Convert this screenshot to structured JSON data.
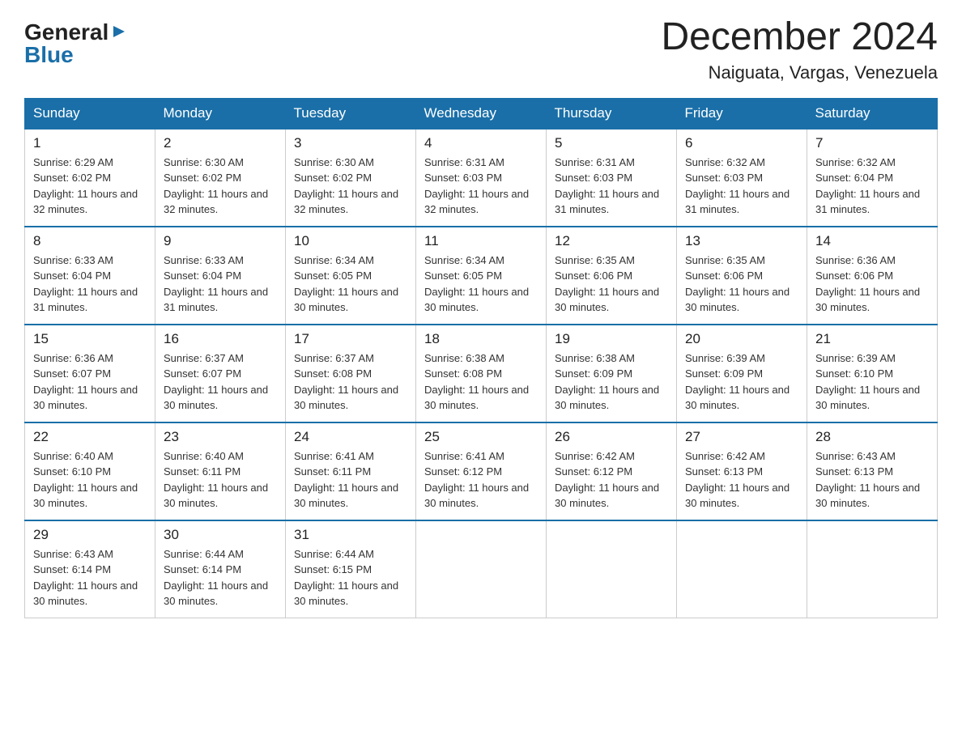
{
  "header": {
    "logo": {
      "general": "General",
      "arrow": "▶",
      "blue": "Blue"
    },
    "title": "December 2024",
    "location": "Naiguata, Vargas, Venezuela"
  },
  "calendar": {
    "days_of_week": [
      "Sunday",
      "Monday",
      "Tuesday",
      "Wednesday",
      "Thursday",
      "Friday",
      "Saturday"
    ],
    "weeks": [
      [
        {
          "day": "1",
          "sunrise": "6:29 AM",
          "sunset": "6:02 PM",
          "daylight": "11 hours and 32 minutes."
        },
        {
          "day": "2",
          "sunrise": "6:30 AM",
          "sunset": "6:02 PM",
          "daylight": "11 hours and 32 minutes."
        },
        {
          "day": "3",
          "sunrise": "6:30 AM",
          "sunset": "6:02 PM",
          "daylight": "11 hours and 32 minutes."
        },
        {
          "day": "4",
          "sunrise": "6:31 AM",
          "sunset": "6:03 PM",
          "daylight": "11 hours and 32 minutes."
        },
        {
          "day": "5",
          "sunrise": "6:31 AM",
          "sunset": "6:03 PM",
          "daylight": "11 hours and 31 minutes."
        },
        {
          "day": "6",
          "sunrise": "6:32 AM",
          "sunset": "6:03 PM",
          "daylight": "11 hours and 31 minutes."
        },
        {
          "day": "7",
          "sunrise": "6:32 AM",
          "sunset": "6:04 PM",
          "daylight": "11 hours and 31 minutes."
        }
      ],
      [
        {
          "day": "8",
          "sunrise": "6:33 AM",
          "sunset": "6:04 PM",
          "daylight": "11 hours and 31 minutes."
        },
        {
          "day": "9",
          "sunrise": "6:33 AM",
          "sunset": "6:04 PM",
          "daylight": "11 hours and 31 minutes."
        },
        {
          "day": "10",
          "sunrise": "6:34 AM",
          "sunset": "6:05 PM",
          "daylight": "11 hours and 30 minutes."
        },
        {
          "day": "11",
          "sunrise": "6:34 AM",
          "sunset": "6:05 PM",
          "daylight": "11 hours and 30 minutes."
        },
        {
          "day": "12",
          "sunrise": "6:35 AM",
          "sunset": "6:06 PM",
          "daylight": "11 hours and 30 minutes."
        },
        {
          "day": "13",
          "sunrise": "6:35 AM",
          "sunset": "6:06 PM",
          "daylight": "11 hours and 30 minutes."
        },
        {
          "day": "14",
          "sunrise": "6:36 AM",
          "sunset": "6:06 PM",
          "daylight": "11 hours and 30 minutes."
        }
      ],
      [
        {
          "day": "15",
          "sunrise": "6:36 AM",
          "sunset": "6:07 PM",
          "daylight": "11 hours and 30 minutes."
        },
        {
          "day": "16",
          "sunrise": "6:37 AM",
          "sunset": "6:07 PM",
          "daylight": "11 hours and 30 minutes."
        },
        {
          "day": "17",
          "sunrise": "6:37 AM",
          "sunset": "6:08 PM",
          "daylight": "11 hours and 30 minutes."
        },
        {
          "day": "18",
          "sunrise": "6:38 AM",
          "sunset": "6:08 PM",
          "daylight": "11 hours and 30 minutes."
        },
        {
          "day": "19",
          "sunrise": "6:38 AM",
          "sunset": "6:09 PM",
          "daylight": "11 hours and 30 minutes."
        },
        {
          "day": "20",
          "sunrise": "6:39 AM",
          "sunset": "6:09 PM",
          "daylight": "11 hours and 30 minutes."
        },
        {
          "day": "21",
          "sunrise": "6:39 AM",
          "sunset": "6:10 PM",
          "daylight": "11 hours and 30 minutes."
        }
      ],
      [
        {
          "day": "22",
          "sunrise": "6:40 AM",
          "sunset": "6:10 PM",
          "daylight": "11 hours and 30 minutes."
        },
        {
          "day": "23",
          "sunrise": "6:40 AM",
          "sunset": "6:11 PM",
          "daylight": "11 hours and 30 minutes."
        },
        {
          "day": "24",
          "sunrise": "6:41 AM",
          "sunset": "6:11 PM",
          "daylight": "11 hours and 30 minutes."
        },
        {
          "day": "25",
          "sunrise": "6:41 AM",
          "sunset": "6:12 PM",
          "daylight": "11 hours and 30 minutes."
        },
        {
          "day": "26",
          "sunrise": "6:42 AM",
          "sunset": "6:12 PM",
          "daylight": "11 hours and 30 minutes."
        },
        {
          "day": "27",
          "sunrise": "6:42 AM",
          "sunset": "6:13 PM",
          "daylight": "11 hours and 30 minutes."
        },
        {
          "day": "28",
          "sunrise": "6:43 AM",
          "sunset": "6:13 PM",
          "daylight": "11 hours and 30 minutes."
        }
      ],
      [
        {
          "day": "29",
          "sunrise": "6:43 AM",
          "sunset": "6:14 PM",
          "daylight": "11 hours and 30 minutes."
        },
        {
          "day": "30",
          "sunrise": "6:44 AM",
          "sunset": "6:14 PM",
          "daylight": "11 hours and 30 minutes."
        },
        {
          "day": "31",
          "sunrise": "6:44 AM",
          "sunset": "6:15 PM",
          "daylight": "11 hours and 30 minutes."
        },
        null,
        null,
        null,
        null
      ]
    ]
  }
}
